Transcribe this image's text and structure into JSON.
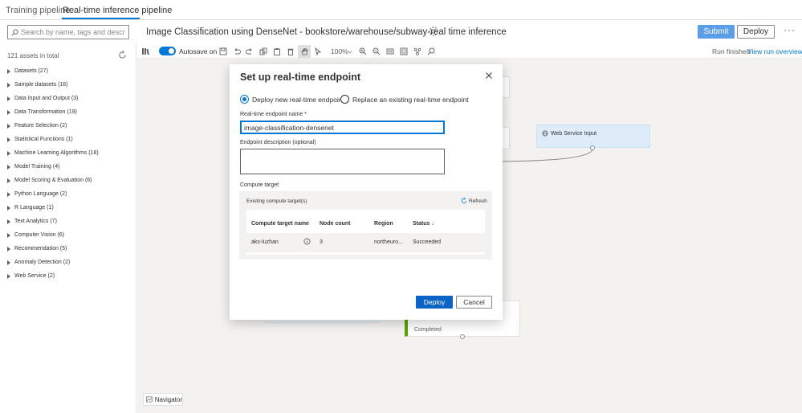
{
  "tabs": [
    {
      "label": "Training pipeline"
    },
    {
      "label": "Real-time inference pipeline"
    }
  ],
  "search": {
    "placeholder": "Search by name, tags and description"
  },
  "header": {
    "title": "Image Classification using DenseNet - bookstore/warehouse/subway-real time inference",
    "submit_label": "Submit",
    "deploy_label": "Deploy",
    "more_label": "···"
  },
  "left_panel": {
    "assets_count": "121 assets in total",
    "categories": [
      {
        "label": "Datasets (27)"
      },
      {
        "label": "Sample datasets (16)"
      },
      {
        "label": "Data Input and Output (3)"
      },
      {
        "label": "Data Transformation (19)"
      },
      {
        "label": "Feature Selection (2)"
      },
      {
        "label": "Statistical Functions (1)"
      },
      {
        "label": "Machine Learning Algorithms (18)"
      },
      {
        "label": "Model Training (4)"
      },
      {
        "label": "Model Scoring & Evaluation (6)"
      },
      {
        "label": "Python Language (2)"
      },
      {
        "label": "R Language (1)"
      },
      {
        "label": "Text Analytics (7)"
      },
      {
        "label": "Computer Vision (6)"
      },
      {
        "label": "Recommendation (5)"
      },
      {
        "label": "Anomaly Detection (2)"
      },
      {
        "label": "Web Service (2)"
      }
    ]
  },
  "toolbar": {
    "autosave_label": "Autosave on",
    "autosave_on": true,
    "zoom_label": "100%",
    "run_status": "Run finished",
    "view_run_label": "View run overview"
  },
  "canvas": {
    "web_service_input_label": "Web Service Input",
    "completed_label": "Completed",
    "navigator_label": "Navigator"
  },
  "modal": {
    "title": "Set up real-time endpoint",
    "option_new": "Deploy new real-time endpoint",
    "option_replace": "Replace an existing real-time endpoint",
    "selected_option": "new",
    "name_label": "Real-time endpoint name *",
    "name_value": "image-classification-densenet",
    "desc_label": "Endpoint description (optional)",
    "desc_value": "",
    "compute_label": "Compute target",
    "existing_label": "Existing compute target(s)",
    "refresh_label": "Refresh",
    "columns": [
      "Compute target name",
      "Node count",
      "Region",
      "Status ↓"
    ],
    "rows": [
      {
        "name": "aks-luzhan",
        "node_count": "3",
        "region": "northeuro...",
        "status": "Succeeded"
      }
    ],
    "deploy_label": "Deploy",
    "cancel_label": "Cancel"
  },
  "colors": {
    "accent": "#0078d4",
    "submit_bg": "#5b9ee8",
    "deploy_bg": "#0b63c4",
    "success": "#57a300",
    "node_highlight": "#deecf9"
  }
}
